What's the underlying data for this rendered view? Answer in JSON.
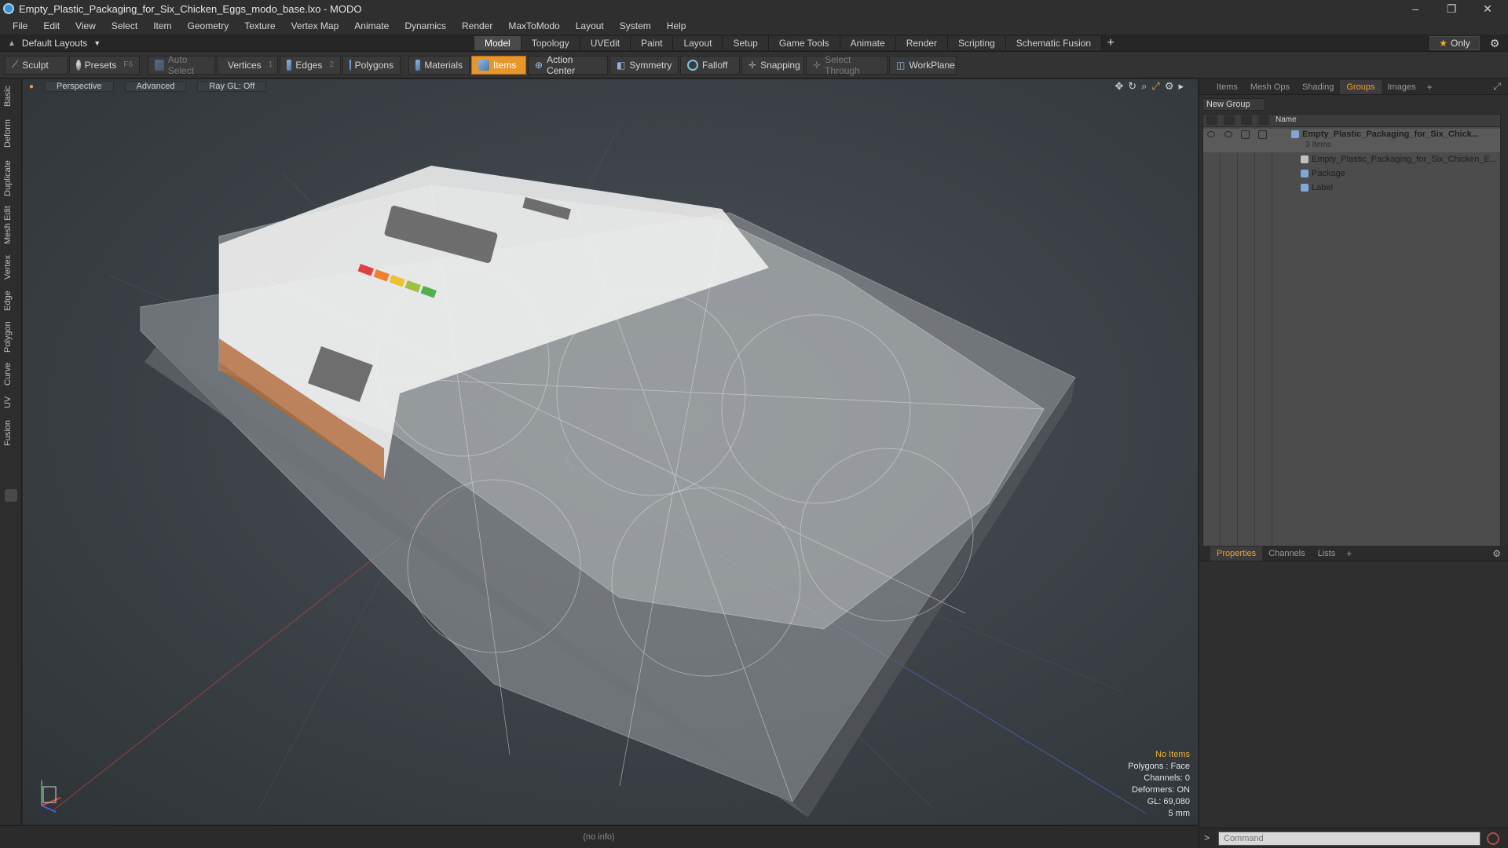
{
  "window": {
    "title": "Empty_Plastic_Packaging_for_Six_Chicken_Eggs_modo_base.lxo - MODO",
    "controls": [
      "–",
      "❐",
      "✕"
    ]
  },
  "menu": [
    "File",
    "Edit",
    "View",
    "Select",
    "Item",
    "Geometry",
    "Texture",
    "Vertex Map",
    "Animate",
    "Dynamics",
    "Render",
    "MaxToModo",
    "Layout",
    "System",
    "Help"
  ],
  "layout": {
    "current": "Default Layouts",
    "tabs": [
      "Model",
      "Topology",
      "UVEdit",
      "Paint",
      "Layout",
      "Setup",
      "Game Tools",
      "Animate",
      "Render",
      "Scripting",
      "Schematic Fusion"
    ],
    "active_tab": "Model",
    "add": "+",
    "only_label": "Only"
  },
  "toolbar": {
    "sculpt": "Sculpt",
    "presets": "Presets",
    "presets_key": "F6",
    "auto_select": "Auto Select",
    "vertices": "Vertices",
    "vertices_key": "1",
    "edges": "Edges",
    "edges_key": "2",
    "polygons": "Polygons",
    "materials": "Materials",
    "items": "Items",
    "action_center": "Action Center",
    "symmetry": "Symmetry",
    "falloff": "Falloff",
    "snapping": "Snapping",
    "select_through": "Select Through",
    "workplane": "WorkPlane"
  },
  "left_tabs": [
    "Basic",
    "Deform",
    "Duplicate",
    "Mesh Edit",
    "Vertex",
    "Edge",
    "Polygon",
    "Curve",
    "UV",
    "Fusion"
  ],
  "viewport": {
    "view": "Perspective",
    "shading": "Advanced",
    "raygl": "Ray GL: Off",
    "stats": {
      "selection": "No Items",
      "polygons": "Polygons : Face",
      "channels": "Channels: 0",
      "deformers": "Deformers: ON",
      "gl": "GL: 69,080",
      "unit": "5 mm"
    }
  },
  "status": {
    "info": "(no info)"
  },
  "right_panel": {
    "top_tabs": [
      "Items",
      "Mesh Ops",
      "Shading",
      "Groups",
      "Images"
    ],
    "active_top_tab": "Groups",
    "new_group": "New Group",
    "name_header": "Name",
    "tree": {
      "group": "Empty_Plastic_Packaging_for_Six_Chick...",
      "group_count": "3 Items",
      "children": [
        "Empty_Plastic_Packaging_for_Six_Chicken_E...",
        "Package",
        "Label"
      ]
    },
    "bottom_tabs": [
      "Properties",
      "Channels",
      "Lists"
    ],
    "active_bottom_tab": "Properties",
    "command_placeholder": "Command",
    "command_prompt": ">"
  },
  "colors": {
    "accent": "#e8962a",
    "active_tab_text": "#f0a030",
    "warning_text": "#f0b030"
  }
}
